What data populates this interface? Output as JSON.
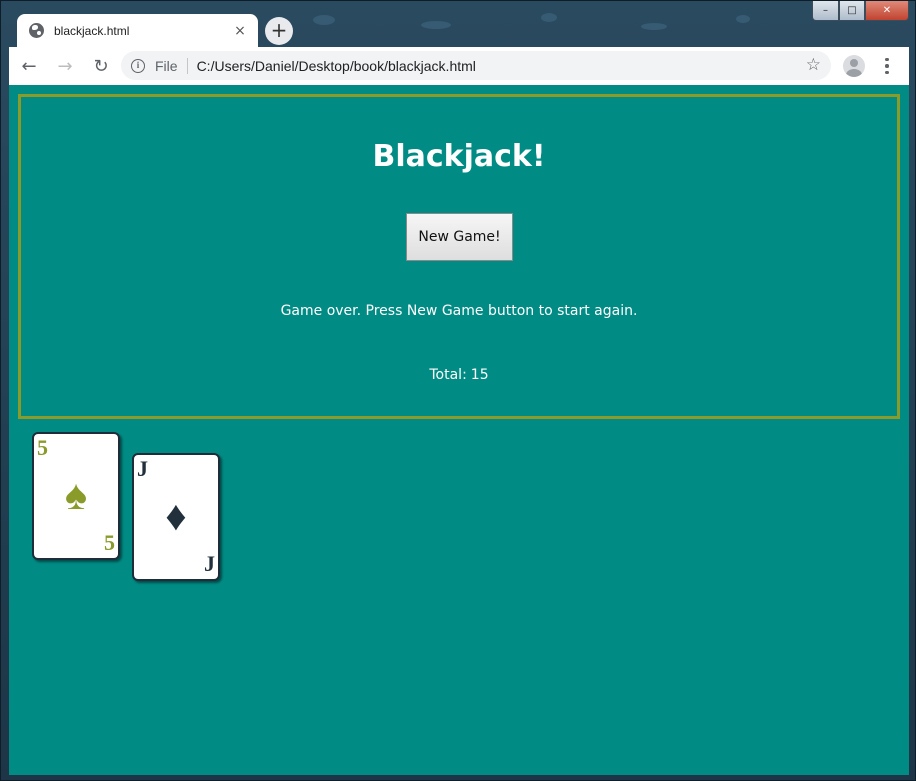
{
  "browser": {
    "tab_title": "blackjack.html",
    "tab_close": "×",
    "new_tab": "+",
    "window_controls": {
      "minimize": "–",
      "maximize": "□",
      "close": "✕"
    },
    "nav": {
      "back": "←",
      "forward": "→",
      "reload": "↻"
    },
    "omnibox": {
      "info_glyph": "i",
      "scheme_label": "File",
      "url": "C:/Users/Daniel/Desktop/book/blackjack.html",
      "star": "☆"
    }
  },
  "game": {
    "title": "Blackjack!",
    "new_game_label": "New Game!",
    "status": "Game over. Press New Game button to start again.",
    "total_label": "Total:",
    "total_value": "15",
    "cards": [
      {
        "rank": "5",
        "suit": "♠",
        "suit_name": "spades",
        "color": "#8a9b2a"
      },
      {
        "rank": "J",
        "suit": "♦",
        "suit_name": "diamonds",
        "color": "#22303c"
      }
    ]
  },
  "colors": {
    "page_bg": "#008b84",
    "panel_border": "#8a9b2a",
    "window_frame": "#1f3a4d"
  }
}
